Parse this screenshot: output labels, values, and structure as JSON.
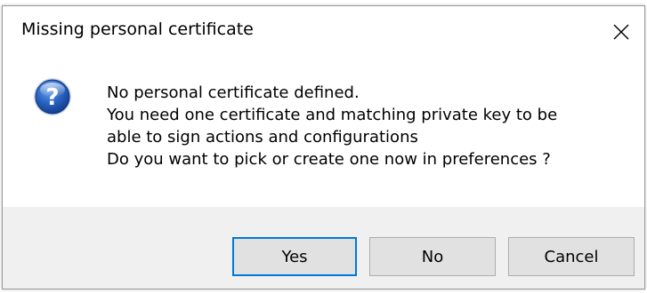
{
  "dialog": {
    "title": "Missing personal certificate",
    "close_icon": "close-icon",
    "icon": "question-icon",
    "message_lines": [
      "No personal certificate defined.",
      "You need one certificate and matching private key to be",
      "able to sign actions and configurations",
      "Do you want to pick or create one now in preferences ?"
    ],
    "buttons": {
      "yes": "Yes",
      "no": "No",
      "cancel": "Cancel"
    },
    "default_button": "yes",
    "colors": {
      "accent": "#0078d7",
      "footer_bg": "#f0f0f0",
      "button_bg": "#e1e1e1",
      "icon_blue": "#1f5fb8"
    }
  }
}
